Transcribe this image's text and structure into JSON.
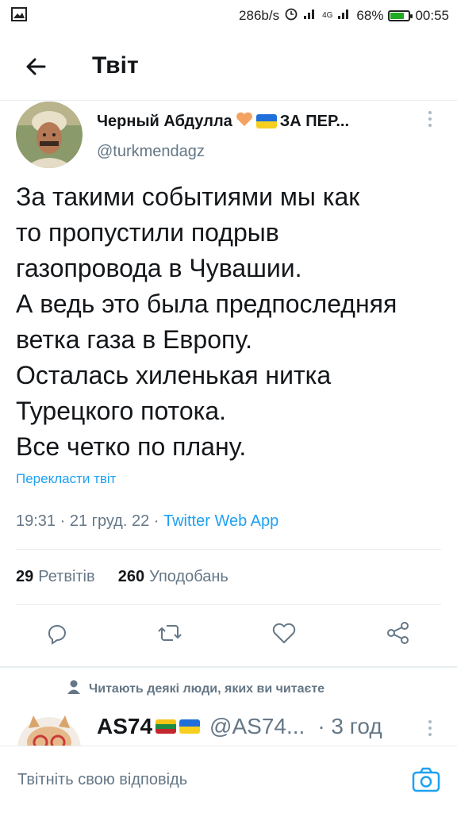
{
  "status_bar": {
    "speed": "286b/s",
    "network": "4G",
    "battery": "68%",
    "battery_level": 0.68,
    "time": "00:55"
  },
  "header": {
    "title": "Твіт",
    "back_icon": "arrow-left-icon"
  },
  "tweet": {
    "author_name": "Черный Абдулла",
    "author_suffix": "ЗА ПЕР...",
    "handle": "@turkmendagz",
    "text_lines": [
      "За такими событиями мы как",
      "то пропустили подрыв",
      "газопровода в Чувашии.",
      "А ведь это была предпоследняя",
      "ветка газа в Европу.",
      "Осталась хиленькая нитка",
      "Турецкого потока.",
      "Все четко по плану."
    ],
    "translate": "Перекласти твіт",
    "time": "19:31",
    "date": "21 груд. 22",
    "source": "Twitter Web App",
    "retweets_count": "29",
    "retweets_label": "Ретвітів",
    "likes_count": "260",
    "likes_label": "Уподобань"
  },
  "social_context": "Читають деякі люди, яких ви читаєте",
  "reply": {
    "name": "AS74",
    "handle": "@AS74...",
    "time": "· 3 год"
  },
  "composer": {
    "placeholder": "Твітніть свою відповідь"
  },
  "colors": {
    "accent": "#1da1f2",
    "muted": "#657786",
    "divider": "#e6ecf0",
    "heart": "#f4a261"
  }
}
